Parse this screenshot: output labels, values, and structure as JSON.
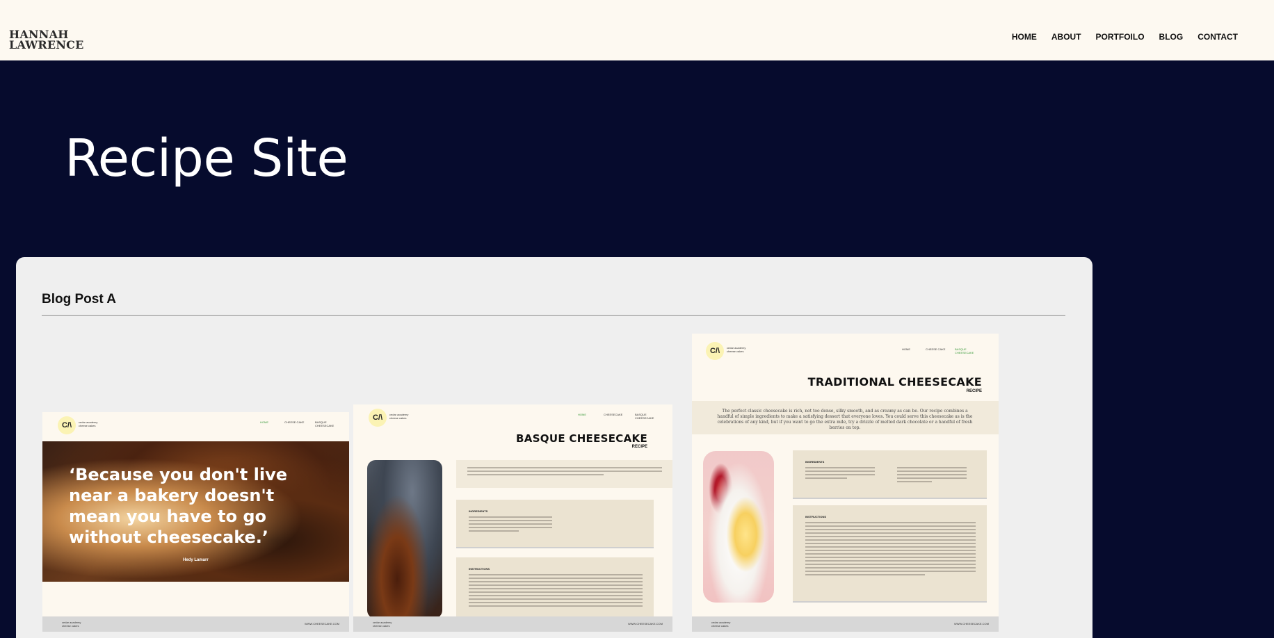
{
  "header": {
    "logo_line1": "HANNAH",
    "logo_line2": "LAWRENCE",
    "nav": [
      "HOME",
      "ABOUT",
      "PORTFOILO",
      "BLOG",
      "CONTACT"
    ]
  },
  "hero": {
    "title": "Recipe Site"
  },
  "post": {
    "title": "Blog Post A",
    "screens": {
      "common": {
        "logo_mark": "C/\\",
        "brand": "cedar academy cheese cakes",
        "footer_url": "WWW.CHEESECAKE.COM"
      },
      "home": {
        "nav": [
          "HOME",
          "CHEESE CAKE",
          "BASQUE CHEESECAKE"
        ],
        "quote": "‘Because you don't live near a bakery doesn't mean you have to go without cheesecake.’",
        "author": "Hedy Lamarr"
      },
      "basque": {
        "nav": [
          "HOME",
          "CHEESECAKE",
          "BASQUE CHEESECAKE"
        ],
        "title": "BASQUE CHEESECAKE",
        "subtitle": "RECIPE",
        "ingredients_label": "INGREDIENTS",
        "instructions_label": "INSTRUCTIONS"
      },
      "traditional": {
        "nav": [
          "HOME",
          "CHEESE CAKE",
          "BASQUE CHEESECAKE"
        ],
        "title": "TRADITIONAL CHEESECAKE",
        "subtitle": "RECIPE",
        "intro": "The perfect classic cheesecake is rich, not too dense, silky smooth, and as creamy as can be. Our recipe combines a handful of simple ingredients to make a satisfying dessert that everyone loves. You could serve this cheesecake as is the celebrations of any kind, but if you want to go the extra mile, try a drizzle of melted dark chocolate or a handful of fresh berries on top.",
        "ingredients_label": "INGREDIENTS",
        "instructions_label": "INSTRUCTIONS"
      }
    }
  }
}
